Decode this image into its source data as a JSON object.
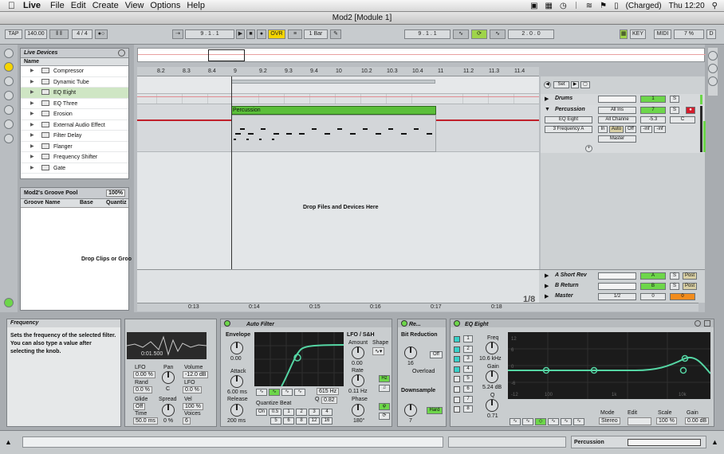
{
  "menubar": {
    "apple": "",
    "app": "Live",
    "items": [
      "File",
      "Edit",
      "Create",
      "View",
      "Options",
      "Help"
    ],
    "battery": "(Charged)",
    "clock": "Thu 12:20"
  },
  "window": {
    "title": "Mod2  [Module 1]"
  },
  "transport": {
    "tap": "TAP",
    "tempo": "140.00",
    "meter": "4 / 4",
    "arr_pos": "9 .   1 .   1",
    "ovr": "OVR",
    "quant": "1 Bar",
    "loop_start": "9 .   1 .   1",
    "loop_len": "2 .   0 .   0",
    "key": "KEY",
    "midi": "MIDI",
    "cpu": "7 %",
    "disk": "D"
  },
  "browser": {
    "title": "Live Devices",
    "column": "Name",
    "devices": [
      "Compressor",
      "Dynamic Tube",
      "EQ Eight",
      "EQ Three",
      "Erosion",
      "External Audio Effect",
      "Filter Delay",
      "Flanger",
      "Frequency Shifter",
      "Gate"
    ]
  },
  "groove": {
    "title": "Mod2's Groove Pool",
    "zoom": "100%",
    "cols": [
      "Groove Name",
      "Base",
      "Quantiz"
    ],
    "hint": "Drop Clips or Groo"
  },
  "arrangement": {
    "ruler": [
      "8.2",
      "8.3",
      "8.4",
      "9",
      "9.2",
      "9.3",
      "9.4",
      "10",
      "10.2",
      "10.3",
      "10.4",
      "11",
      "11.2",
      "11.3",
      "11.4"
    ],
    "clip_name": "Percussion",
    "drop_hint": "Drop Files and Devices Here",
    "time": [
      "0:13",
      "0:14",
      "0:15",
      "0:16",
      "0:17",
      "0:18"
    ],
    "zoom": "1/8",
    "set_btn": "Set"
  },
  "tracks": {
    "drums": {
      "name": "Drums",
      "num": "1",
      "solo": "S"
    },
    "perc": {
      "name": "Percussion",
      "num": "7",
      "solo": "S",
      "input": "All Ins",
      "channel": "All Channe",
      "device": "EQ Eight",
      "param": "3 Frequency A",
      "vol": "-5.3",
      "pan": "C",
      "in": "In",
      "auto": "Auto",
      "off": "Off",
      "out": "Master",
      "peak1": "-inf",
      "peak2": "-inf"
    },
    "short_rev": {
      "name": "A Short Rev",
      "letter": "A",
      "solo": "S",
      "post": "Post"
    },
    "b_return": {
      "name": "B Return",
      "letter": "B",
      "solo": "S",
      "post": "Post"
    },
    "master": {
      "name": "Master",
      "cue": "1/2",
      "vol": "0",
      "pan": "0"
    }
  },
  "info": {
    "title": "Frequency",
    "text": "Sets the frequency of the selected filter. You can also type a value after selecting the knob."
  },
  "simpler": {
    "time": "0:01.500",
    "lfo": "LFO",
    "lfo_val": "0.00 %",
    "pan": "Pan",
    "pan_val": "C",
    "volume": "Volume",
    "vol_val": "-12.0 dB",
    "rand": "Rand",
    "rand_val": "0.0 %",
    "lfo2": "LFO",
    "lfo2_val": "0.0 %",
    "glide": "Glide",
    "glide_val": "Off",
    "spread": "Spread",
    "spread_val": "0 %",
    "vel": "Vel",
    "vel_val": "100 %",
    "time_lbl": "Time",
    "time_val": "50.0 ms",
    "voices": "Voices",
    "voices_val": "6"
  },
  "autofilter": {
    "title": "Auto Filter",
    "envelope": "Envelope",
    "env_val": "0.00",
    "attack": "Attack",
    "attack_val": "6.00 ms",
    "release": "Release",
    "release_val": "200 ms",
    "freq_val": "615 Hz",
    "q": "Q",
    "q_val": "0.82",
    "quant": "Quantize Beat",
    "qbtns": [
      "On",
      "0.5",
      "1",
      "2",
      "3",
      "4",
      "5",
      "6",
      "8",
      "12",
      "16"
    ],
    "lfo": "LFO / S&H",
    "amount": "Amount",
    "amount_val": "0.00",
    "shape": "Shape",
    "rate": "Rate",
    "rate_val": "0.11 Hz",
    "phase": "Phase",
    "phase_val": "180°",
    "hz": "Hz"
  },
  "redux": {
    "title": "Re...",
    "bit": "Bit Reduction",
    "bit_val": "16",
    "off": "Off",
    "overload": "Overload",
    "down": "Downsample",
    "down_val": "7",
    "hard": "Hard"
  },
  "eq": {
    "title": "EQ Eight",
    "bands": [
      "1",
      "2",
      "3",
      "4",
      "5",
      "6",
      "7",
      "8"
    ],
    "freq": "Freq",
    "freq_val": "10.6 kHz",
    "gain": "Gain",
    "gain_val": "5.24 dB",
    "q": "Q",
    "q_val": "0.71",
    "mode": "Mode",
    "mode_val": "Stereo",
    "edit": "Edit",
    "scale": "Scale",
    "scale_val": "100 %",
    "gain2": "Gain",
    "gain2_val": "0.00 dB",
    "grid_left": [
      "12",
      "6",
      "0",
      "-6",
      "-12"
    ],
    "freq_marks": [
      "100",
      "1k",
      "10k"
    ]
  },
  "status": {
    "track": "Percussion"
  },
  "colors": {
    "clip": "#5bbf3a",
    "accent": "#9fd44a",
    "orange": "#f28c1c",
    "playhead": "#c0202a"
  }
}
